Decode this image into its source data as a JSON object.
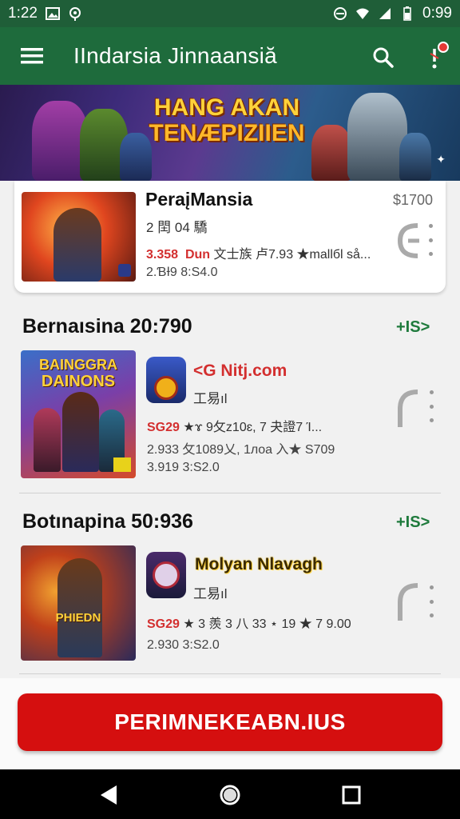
{
  "status_bar": {
    "time_left": "1:22",
    "time_right": "0:99"
  },
  "app_bar": {
    "title": "IIndarsia Jinnaansiă"
  },
  "banner": {
    "title_line1": "HANG AKAN",
    "title_line2": "TENÆPIZIIEN"
  },
  "featured": {
    "title": "PeraįMansia",
    "subtitle": "2 䦌 04 驕",
    "meta_red": "3.358",
    "meta_red2": "Dun",
    "meta_rest": "文士族 卢7.93 ★mallбl så...",
    "meta2": "2.ƁƗ9  8:S4.0",
    "price": "$1700"
  },
  "sections": [
    {
      "title": "Bernaısina 20:790",
      "see_all": "+IS>",
      "item": {
        "thumb_text1": "BAINGGRA",
        "thumb_text2": "DAINONS",
        "brand": "<G Nitj.com",
        "subtitle": "工易ıl",
        "meta_red": "SG29",
        "meta_rest": "★ɤ 9攵z10ɛ, 7 夬證7 Ί...",
        "meta2": "2.933  攵1089乂, 1лoa 入★ S709",
        "meta3": "3.919  3:S2.0"
      }
    },
    {
      "title": "Botınapina 50:936",
      "see_all": "+IS>",
      "item": {
        "thumb_text": "PHIEDN",
        "brand": "Molyan Nlavagh",
        "subtitle": "工易ıl",
        "meta_red": "SG29",
        "meta_rest": "★ 3 羨 3 八 33 ⋆ 19 ★ 7 9.00",
        "meta3": "2.930  3:S2.0"
      }
    }
  ],
  "cta": {
    "label": "PERIMNEKEABN.IUS"
  },
  "colors": {
    "status_bar": "#1f5e38",
    "app_bar": "#1e6b3c",
    "accent_green": "#1e7a3c",
    "cta_red": "#d50f0f",
    "price_red": "#d32f2f"
  },
  "icons": [
    "menu-icon",
    "search-icon",
    "notification-icon",
    "download-icon",
    "more-vert-icon",
    "back-icon",
    "home-icon",
    "recents-icon",
    "wifi-icon",
    "signal-icon",
    "battery-icon"
  ]
}
